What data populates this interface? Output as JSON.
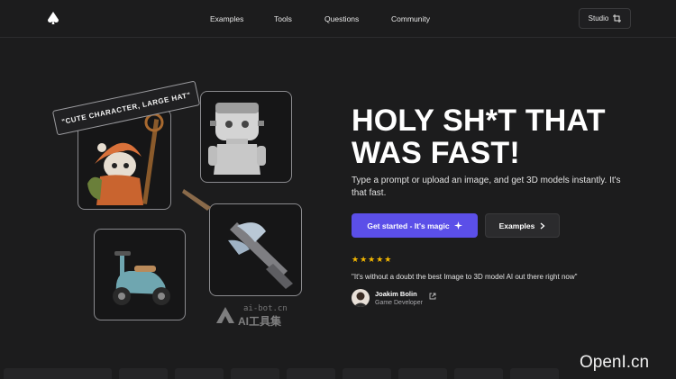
{
  "nav": {
    "logo_icon": "spade-logo-icon",
    "links": [
      "Examples",
      "Tools",
      "Questions",
      "Community"
    ],
    "studio_label": "Studio",
    "studio_icon": "crop-icon"
  },
  "gallery": {
    "prompt_tag": "\"CUTE CHARACTER, LARGE HAT\"",
    "cards": [
      "wizard-character-model",
      "frankenstein-figurine-model",
      "scooter-model",
      "ornate-sword-model"
    ]
  },
  "watermark": {
    "url": "ai-bot.cn",
    "name": "AI工具集"
  },
  "hero": {
    "headline": "HOLY SH*T THAT WAS FAST!",
    "subtext": "Type a prompt or upload an image, and get 3D models instantly. It's that fast.",
    "primary_cta": "Get started - It's magic",
    "primary_icon": "sparkle-icon",
    "secondary_cta": "Examples",
    "secondary_icon": "chevron-right-icon"
  },
  "testimonial": {
    "rating": 5,
    "stars": "★★★★★",
    "star_color": "#f5b800",
    "quote": "\"It's without a doubt the best Image to 3D model AI out there right now\"",
    "author": "Joakim Bolin",
    "role": "Game Developer",
    "link_icon": "external-link-icon"
  },
  "overlay_watermark": "OpenI.cn",
  "colors": {
    "background": "#1c1c1d",
    "accent": "#5b4fe8",
    "card_border": "#8a8a8e"
  }
}
